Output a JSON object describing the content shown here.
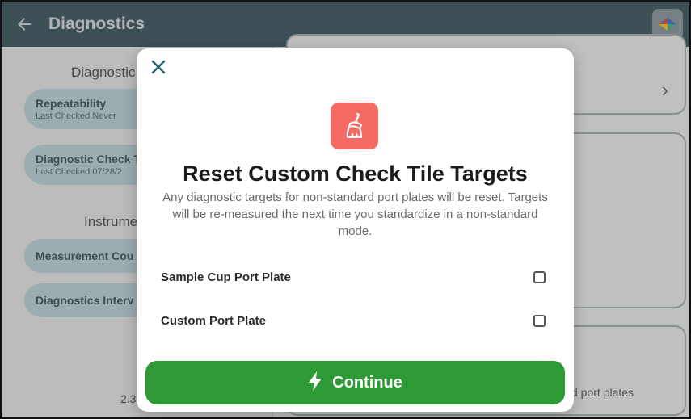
{
  "header": {
    "title": "Diagnostics",
    "back_icon": "back-arrow-icon",
    "logo_icon": "app-logo-icon"
  },
  "background": {
    "left": {
      "section1": "Diagnostic",
      "pill1_title": "Repeatability",
      "pill1_sub": "Last Checked:Never",
      "pill2_title": "Diagnostic Check T",
      "pill2_sub": "Last Checked:07/28/2",
      "section2": "Instrume",
      "pill3_title": "Measurement Cou",
      "pill4_title": "Diagnostics Interv",
      "version": "2.3"
    },
    "right": {
      "footer_text": "d port plates"
    }
  },
  "modal": {
    "close_icon": "close-icon",
    "icon": "broom-icon",
    "title": "Reset Custom Check Tile Targets",
    "description": "Any diagnostic targets for non-standard port plates will be reset. Targets will be re-measured the next time you standardize in a non-standard mode.",
    "options": [
      {
        "label": "Sample Cup Port Plate",
        "checked": false
      },
      {
        "label": "Custom Port Plate",
        "checked": false
      }
    ],
    "continue_label": "Continue",
    "continue_icon": "lightning-icon"
  },
  "colors": {
    "header_bg": "#1d3e48",
    "accent": "#2e9a36",
    "icon_bg": "#f46b64"
  }
}
